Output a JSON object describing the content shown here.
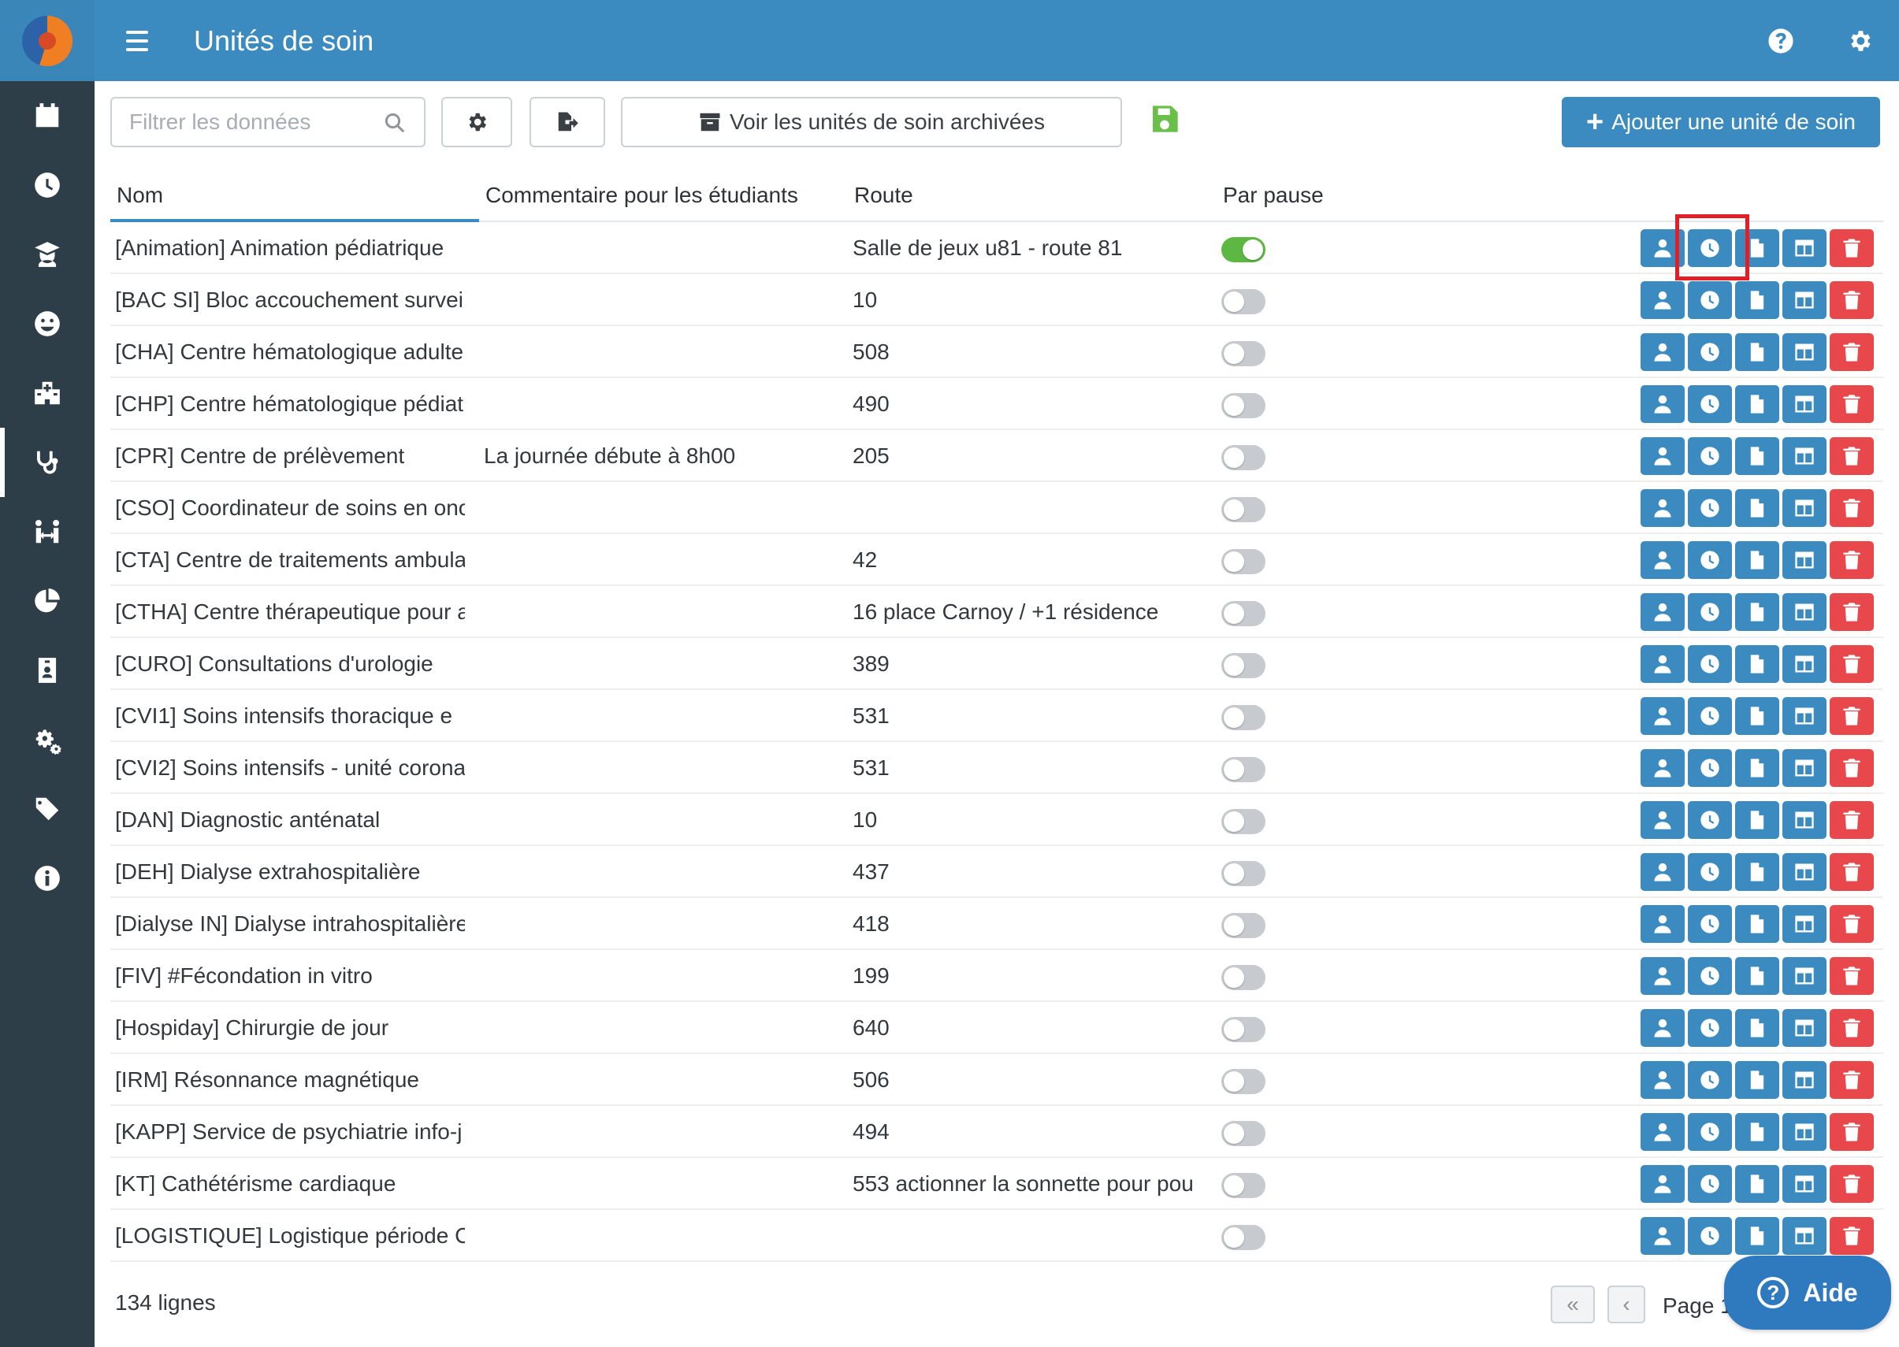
{
  "header": {
    "title": "Unités de soin",
    "right_icons": [
      "help-icon",
      "gear-icon"
    ]
  },
  "sidebar": {
    "items": [
      {
        "icon": "calendar-icon"
      },
      {
        "icon": "clock-icon"
      },
      {
        "icon": "graduate-icon"
      },
      {
        "icon": "smiley-icon"
      },
      {
        "icon": "hospital-icon"
      },
      {
        "icon": "stethoscope-icon",
        "active": true
      },
      {
        "icon": "people-arrows-icon"
      },
      {
        "icon": "pie-chart-icon"
      },
      {
        "icon": "id-badge-icon"
      },
      {
        "icon": "cogs-icon"
      },
      {
        "icon": "tags-icon"
      },
      {
        "icon": "info-icon"
      }
    ]
  },
  "toolbar": {
    "search_placeholder": "Filtrer les données",
    "archived_label": "Voir les unités de soin archivées",
    "add_label": "Ajouter une unité de soin"
  },
  "table": {
    "columns": {
      "nom": "Nom",
      "commentaire": "Commentaire pour les étudiants",
      "route": "Route",
      "pause": "Par pause"
    },
    "rows": [
      {
        "nom": "[Animation] Animation pédiatrique",
        "commentaire": "",
        "route": "Salle de jeux u81 - route 81",
        "pause": true
      },
      {
        "nom": "[BAC SI] Bloc accouchement survei",
        "commentaire": "",
        "route": "10",
        "pause": false
      },
      {
        "nom": "[CHA] Centre hématologique adulte",
        "commentaire": "",
        "route": "508",
        "pause": false
      },
      {
        "nom": "[CHP] Centre hématologique pédiat",
        "commentaire": "",
        "route": "490",
        "pause": false
      },
      {
        "nom": "[CPR] Centre de prélèvement",
        "commentaire": "La journée débute à 8h00",
        "route": "205",
        "pause": false
      },
      {
        "nom": "[CSO] Coordinateur de soins en onc",
        "commentaire": "",
        "route": "",
        "pause": false
      },
      {
        "nom": "[CTA] Centre de traitements ambula",
        "commentaire": "",
        "route": "42",
        "pause": false
      },
      {
        "nom": "[CTHA] Centre thérapeutique pour a",
        "commentaire": "",
        "route": "16 place Carnoy / +1 résidence",
        "pause": false
      },
      {
        "nom": "[CURO] Consultations d'urologie",
        "commentaire": "",
        "route": "389",
        "pause": false
      },
      {
        "nom": "[CVI1]  Soins intensifs thoracique e",
        "commentaire": "",
        "route": "531",
        "pause": false
      },
      {
        "nom": "[CVI2] Soins intensifs - unité corona",
        "commentaire": "",
        "route": "531",
        "pause": false
      },
      {
        "nom": "[DAN] Diagnostic anténatal",
        "commentaire": "",
        "route": "10",
        "pause": false
      },
      {
        "nom": "[DEH] Dialyse extrahospitalière",
        "commentaire": "",
        "route": "437",
        "pause": false
      },
      {
        "nom": "[Dialyse IN] Dialyse intrahospitalière",
        "commentaire": "",
        "route": "418",
        "pause": false
      },
      {
        "nom": "[FIV]  #Fécondation in vitro",
        "commentaire": "",
        "route": "199",
        "pause": false
      },
      {
        "nom": "[Hospiday] Chirurgie de jour",
        "commentaire": "",
        "route": "640",
        "pause": false
      },
      {
        "nom": "[IRM] Résonnance magnétique",
        "commentaire": "",
        "route": "506",
        "pause": false
      },
      {
        "nom": "[KAPP] Service de psychiatrie info-j",
        "commentaire": "",
        "route": "494",
        "pause": false
      },
      {
        "nom": "[KT] Cathétérisme cardiaque",
        "commentaire": "",
        "route": "553 actionner la sonnette pour pou",
        "pause": false
      },
      {
        "nom": "[LOGISTIQUE] Logistique période C",
        "commentaire": "",
        "route": "",
        "pause": false
      }
    ],
    "row_action_icons": [
      "user-icon",
      "clock-icon",
      "file-icon",
      "columns-icon",
      "trash-icon"
    ]
  },
  "footer": {
    "count": "134 lignes",
    "page_label": "Page 1",
    "help_label": "Aide"
  },
  "colors": {
    "primary": "#3b8ac0",
    "sidebar": "#2d3e48",
    "danger": "#e8474b",
    "success": "#5cb842",
    "highlight": "#e21f26"
  }
}
